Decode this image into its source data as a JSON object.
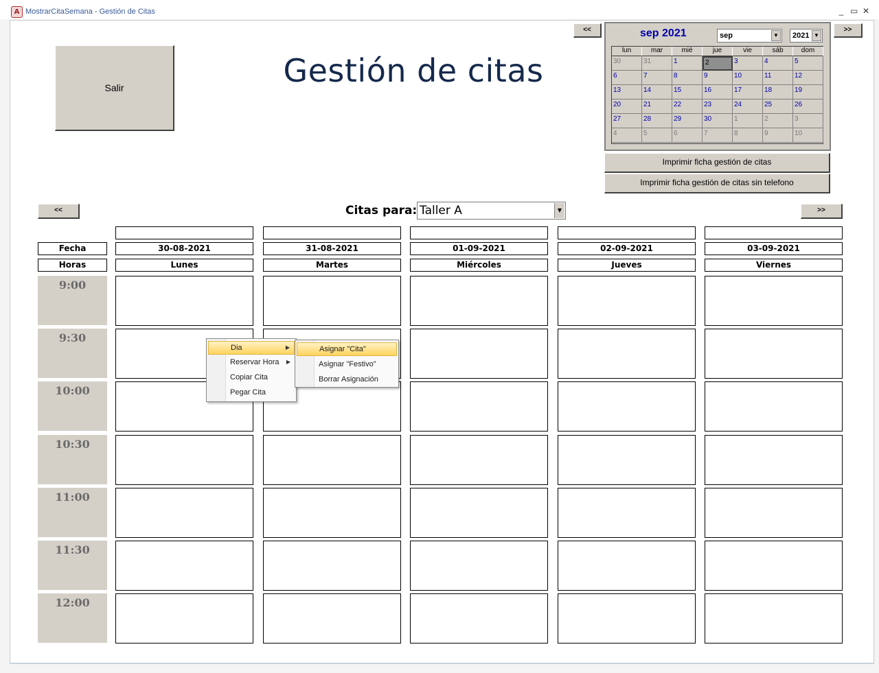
{
  "window": {
    "title": "MostrarCitaSemana - Gestión de Citas",
    "controls": [
      "_",
      "▭",
      "✕"
    ]
  },
  "page": {
    "exit_label": "Salir",
    "title": "Gestión de citas"
  },
  "calendar": {
    "header": "sep 2021",
    "month_select": "sep",
    "year_select": "2021",
    "prev_label": "<<",
    "next_label": ">>",
    "day_names": [
      "lun",
      "mar",
      "mié",
      "jue",
      "vie",
      "sáb",
      "dom"
    ],
    "weeks": [
      [
        "30",
        "31",
        "1",
        "2",
        "3",
        "4",
        "5"
      ],
      [
        "6",
        "7",
        "8",
        "9",
        "10",
        "11",
        "12"
      ],
      [
        "13",
        "14",
        "15",
        "16",
        "17",
        "18",
        "19"
      ],
      [
        "20",
        "21",
        "22",
        "23",
        "24",
        "25",
        "26"
      ],
      [
        "27",
        "28",
        "29",
        "30",
        "1",
        "2",
        "3"
      ],
      [
        "4",
        "5",
        "6",
        "7",
        "8",
        "9",
        "10"
      ]
    ],
    "selected": "2"
  },
  "print": {
    "btn1": "Imprimir ficha gestión de citas",
    "btn2": "Imprimir ficha gestión de citas sin telefono"
  },
  "nav": {
    "prev_week": "<<",
    "next_week": ">>"
  },
  "citas": {
    "label": "Citas para:",
    "value": "Taller A"
  },
  "schedule": {
    "fecha_label": "Fecha",
    "horas_label": "Horas",
    "dates": [
      "30-08-2021",
      "31-08-2021",
      "01-09-2021",
      "02-09-2021",
      "03-09-2021"
    ],
    "days": [
      "Lunes",
      "Martes",
      "Miércoles",
      "Jueves",
      "Viernes"
    ],
    "times": [
      "9:00",
      "9:30",
      "10:00",
      "10:30",
      "11:00",
      "11:30",
      "12:00"
    ]
  },
  "context_menu": {
    "items": [
      "Dia",
      "Reservar Hora",
      "Copiar Cita",
      "Pegar Cita"
    ],
    "submenu": [
      "Asignar \"Cita\"",
      "Asignar \"Festivo\"",
      "Borrar Asignación"
    ]
  }
}
